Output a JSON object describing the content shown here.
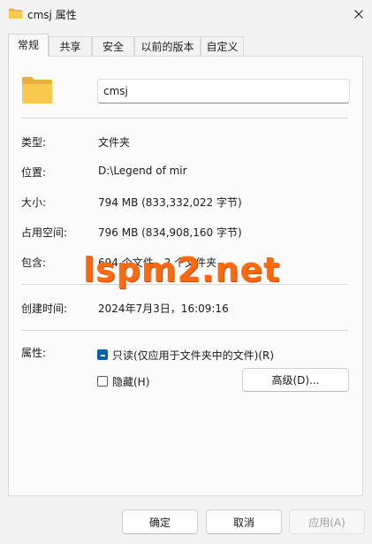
{
  "window": {
    "title": "cmsj 属性"
  },
  "tabs": [
    {
      "label": "常规",
      "active": true
    },
    {
      "label": "共享",
      "active": false
    },
    {
      "label": "安全",
      "active": false
    },
    {
      "label": "以前的版本",
      "active": false
    },
    {
      "label": "自定义",
      "active": false
    }
  ],
  "general": {
    "folder_name": "cmsj",
    "type_label": "类型:",
    "type_value": "文件夹",
    "location_label": "位置:",
    "location_value": "D:\\Legend of mir",
    "size_label": "大小:",
    "size_value": "794 MB (833,332,022 字节)",
    "size_on_disk_label": "占用空间:",
    "size_on_disk_value": "796 MB (834,908,160 字节)",
    "contains_label": "包含:",
    "contains_value": "694 个文件，2 个文件夹",
    "created_label": "创建时间:",
    "created_value": "2024年7月3日，16:09:16",
    "attributes_label": "属性:",
    "readonly_label": "只读(仅应用于文件夹中的文件)(R)",
    "readonly_checked": true,
    "hidden_label": "隐藏(H)",
    "hidden_checked": false,
    "advanced_button": "高级(D)..."
  },
  "footer": {
    "ok": "确定",
    "cancel": "取消",
    "apply": "应用(A)"
  },
  "watermark": "lspm2.net",
  "colors": {
    "accent": "#0a5fb4",
    "folder": "#f8c94d",
    "watermark": "#ff6a10"
  },
  "icons": {
    "title": "folder-icon",
    "close": "close-icon",
    "main": "folder-icon"
  }
}
